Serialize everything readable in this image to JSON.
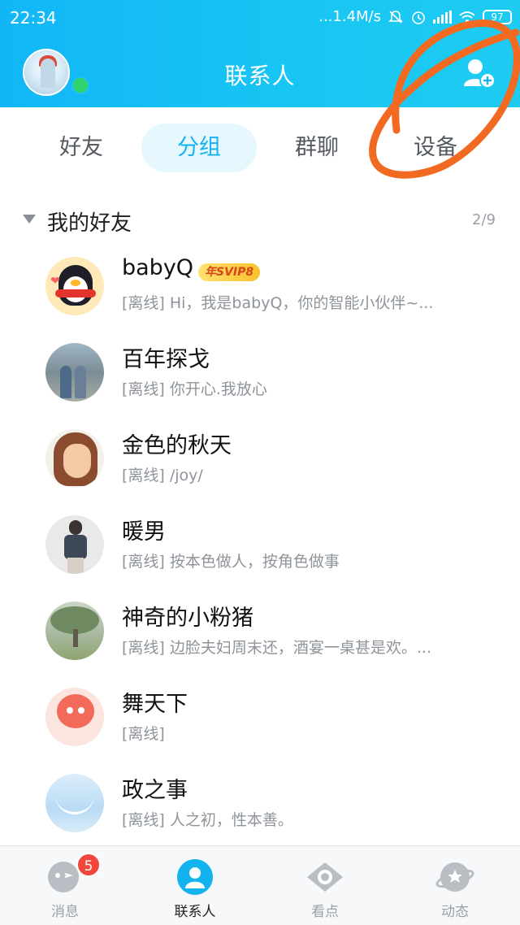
{
  "status_bar": {
    "time": "22:34",
    "network_speed": "...1.4M/s",
    "battery": "97"
  },
  "header": {
    "title": "联系人",
    "add_friend_icon": "add-contact-icon",
    "online_status_color": "#2fd36b",
    "accent": "#14b3ef"
  },
  "tabs": [
    {
      "label": "好友",
      "active": false
    },
    {
      "label": "分组",
      "active": true
    },
    {
      "label": "群聊",
      "active": false
    },
    {
      "label": "设备",
      "active": false
    }
  ],
  "group": {
    "name": "我的好友",
    "count": "2/9"
  },
  "contacts": [
    {
      "name": "babyQ",
      "badge": "年SVIP8",
      "signature": "[离线] Hi，我是babyQ，你的智能小伙伴~..."
    },
    {
      "name": "百年探戈",
      "signature": "[离线] 你开心.我放心"
    },
    {
      "name": "金色的秋天",
      "signature": "[离线] /joy/"
    },
    {
      "name": "暖男",
      "signature": "[离线] 按本色做人，按角色做事"
    },
    {
      "name": "神奇的小粉猪",
      "signature": "[离线] 边脸夫妇周末还，酒宴一桌甚是欢。..."
    },
    {
      "name": "舞天下",
      "signature": "[离线]"
    },
    {
      "name": "政之事",
      "signature": "[离线] 人之初，性本善。"
    }
  ],
  "bottom_nav": [
    {
      "label": "消息",
      "icon": "message-icon",
      "badge": "5",
      "active": false
    },
    {
      "label": "联系人",
      "icon": "contacts-icon",
      "active": true
    },
    {
      "label": "看点",
      "icon": "eye-icon",
      "active": false
    },
    {
      "label": "动态",
      "icon": "planet-icon",
      "active": false
    }
  ],
  "annotation_color": "#f26a21"
}
